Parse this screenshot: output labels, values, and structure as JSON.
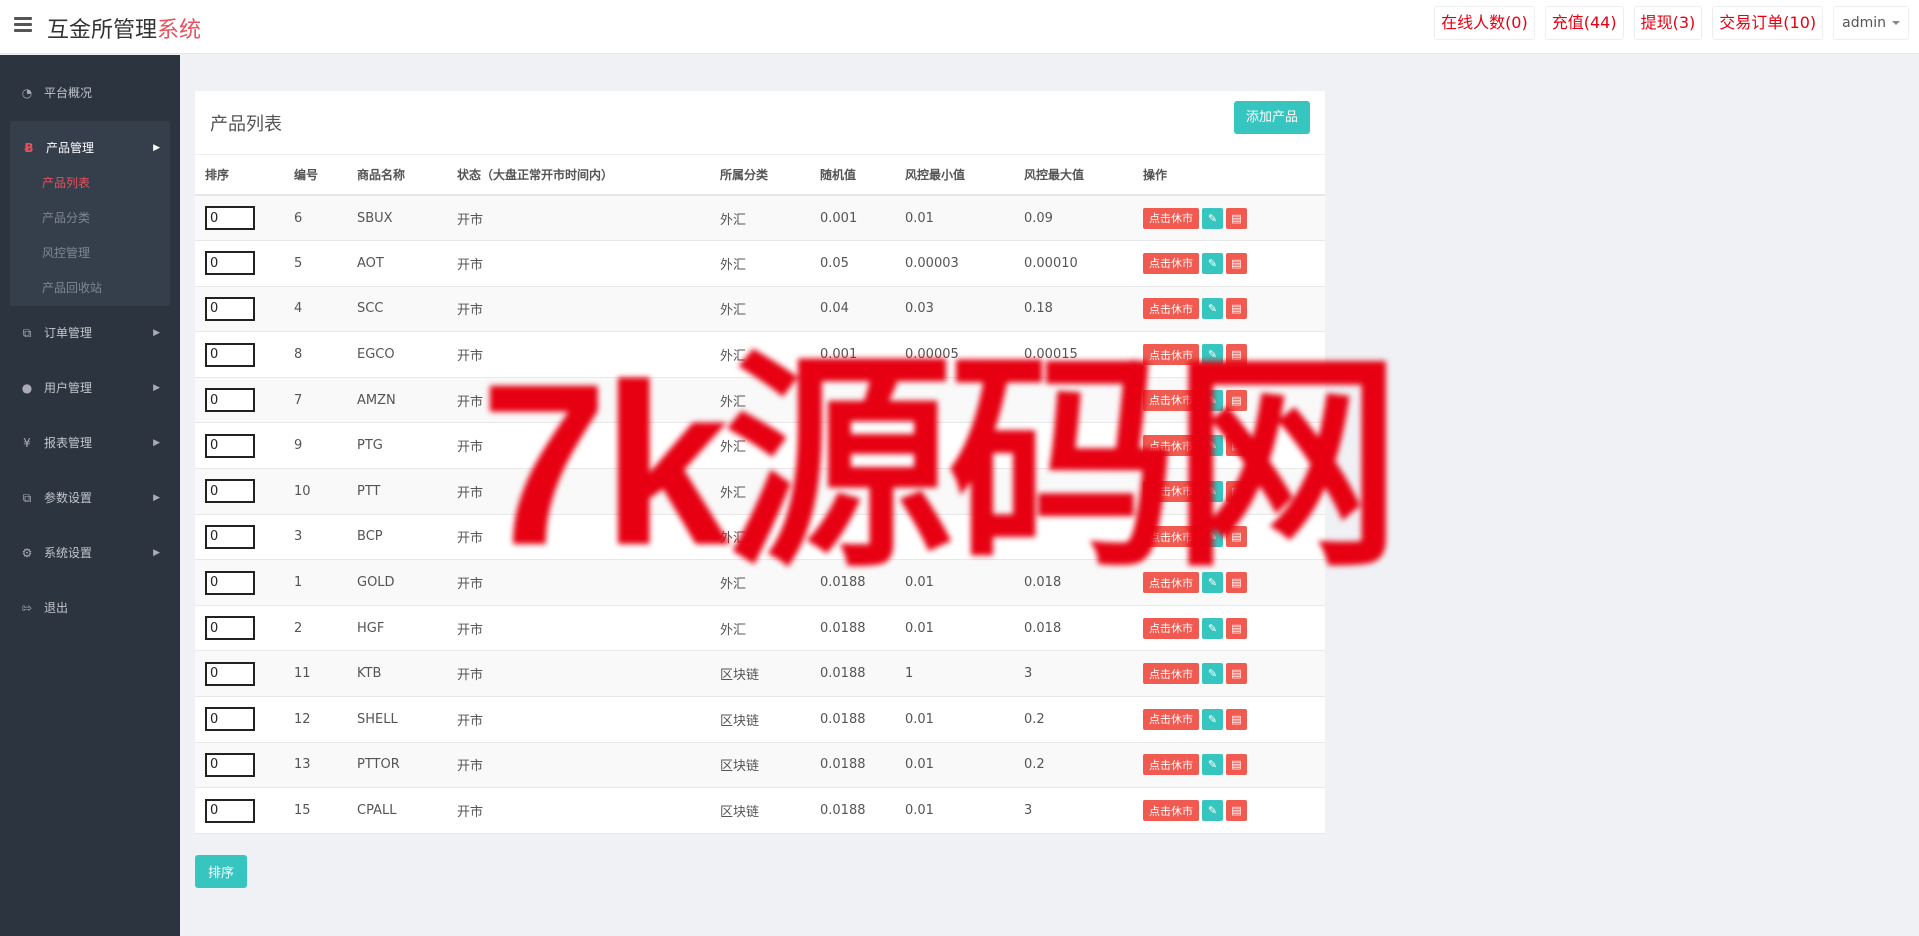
{
  "app": {
    "title_main": "互金所管理",
    "title_accent": "系统"
  },
  "topbar": {
    "links": [
      "在线人数(0)",
      "充值(44)",
      "提现(3)",
      "交易订单(10)"
    ],
    "user": "admin"
  },
  "sidebar": {
    "items": [
      {
        "label": "平台概况",
        "icon": "dashboard-icon"
      },
      {
        "label": "产品管理",
        "icon": "bitcoin-icon",
        "expanded": true,
        "children": [
          "产品列表",
          "产品分类",
          "风控管理",
          "产品回收站"
        ],
        "active_child": 0
      },
      {
        "label": "订单管理",
        "icon": "copy-icon"
      },
      {
        "label": "用户管理",
        "icon": "user-icon"
      },
      {
        "label": "报表管理",
        "icon": "yen-icon"
      },
      {
        "label": "参数设置",
        "icon": "copy-icon"
      },
      {
        "label": "系统设置",
        "icon": "gears-icon"
      },
      {
        "label": "退出",
        "icon": "sign-out-icon"
      }
    ]
  },
  "panel": {
    "title": "产品列表",
    "add_label": "添加产品",
    "sort_label": "排序",
    "op_close_label": "点击休市",
    "columns": [
      "排序",
      "编号",
      "商品名称",
      "状态（大盘正常开市时间内）",
      "所属分类",
      "随机值",
      "风控最小值",
      "风控最大值",
      "操作"
    ],
    "rows": [
      {
        "sort": "0",
        "id": "6",
        "name": "SBUX",
        "status": "开市",
        "category": "外汇",
        "random": "0.001",
        "min": "0.01",
        "max": "0.09"
      },
      {
        "sort": "0",
        "id": "5",
        "name": "AOT",
        "status": "开市",
        "category": "外汇",
        "random": "0.05",
        "min": "0.00003",
        "max": "0.00010"
      },
      {
        "sort": "0",
        "id": "4",
        "name": "SCC",
        "status": "开市",
        "category": "外汇",
        "random": "0.04",
        "min": "0.03",
        "max": "0.18"
      },
      {
        "sort": "0",
        "id": "8",
        "name": "EGCO",
        "status": "开市",
        "category": "外汇",
        "random": "0.001",
        "min": "0.00005",
        "max": "0.00015"
      },
      {
        "sort": "0",
        "id": "7",
        "name": "AMZN",
        "status": "开市",
        "category": "外汇",
        "random": "",
        "min": "",
        "max": ""
      },
      {
        "sort": "0",
        "id": "9",
        "name": "PTG",
        "status": "开市",
        "category": "外汇",
        "random": "",
        "min": "",
        "max": ""
      },
      {
        "sort": "0",
        "id": "10",
        "name": "PTT",
        "status": "开市",
        "category": "外汇",
        "random": "",
        "min": "",
        "max": ""
      },
      {
        "sort": "0",
        "id": "3",
        "name": "BCP",
        "status": "开市",
        "category": "外汇",
        "random": "",
        "min": "",
        "max": ""
      },
      {
        "sort": "0",
        "id": "1",
        "name": "GOLD",
        "status": "开市",
        "category": "外汇",
        "random": "0.0188",
        "min": "0.01",
        "max": "0.018"
      },
      {
        "sort": "0",
        "id": "2",
        "name": "HGF",
        "status": "开市",
        "category": "外汇",
        "random": "0.0188",
        "min": "0.01",
        "max": "0.018"
      },
      {
        "sort": "0",
        "id": "11",
        "name": "KTB",
        "status": "开市",
        "category": "区块链",
        "random": "0.0188",
        "min": "1",
        "max": "3"
      },
      {
        "sort": "0",
        "id": "12",
        "name": "SHELL",
        "status": "开市",
        "category": "区块链",
        "random": "0.0188",
        "min": "0.01",
        "max": "0.2"
      },
      {
        "sort": "0",
        "id": "13",
        "name": "PTTOR",
        "status": "开市",
        "category": "区块链",
        "random": "0.0188",
        "min": "0.01",
        "max": "0.2"
      },
      {
        "sort": "0",
        "id": "15",
        "name": "CPALL",
        "status": "开市",
        "category": "区块链",
        "random": "0.0188",
        "min": "0.01",
        "max": "3"
      }
    ]
  },
  "watermark": "7k源码网"
}
